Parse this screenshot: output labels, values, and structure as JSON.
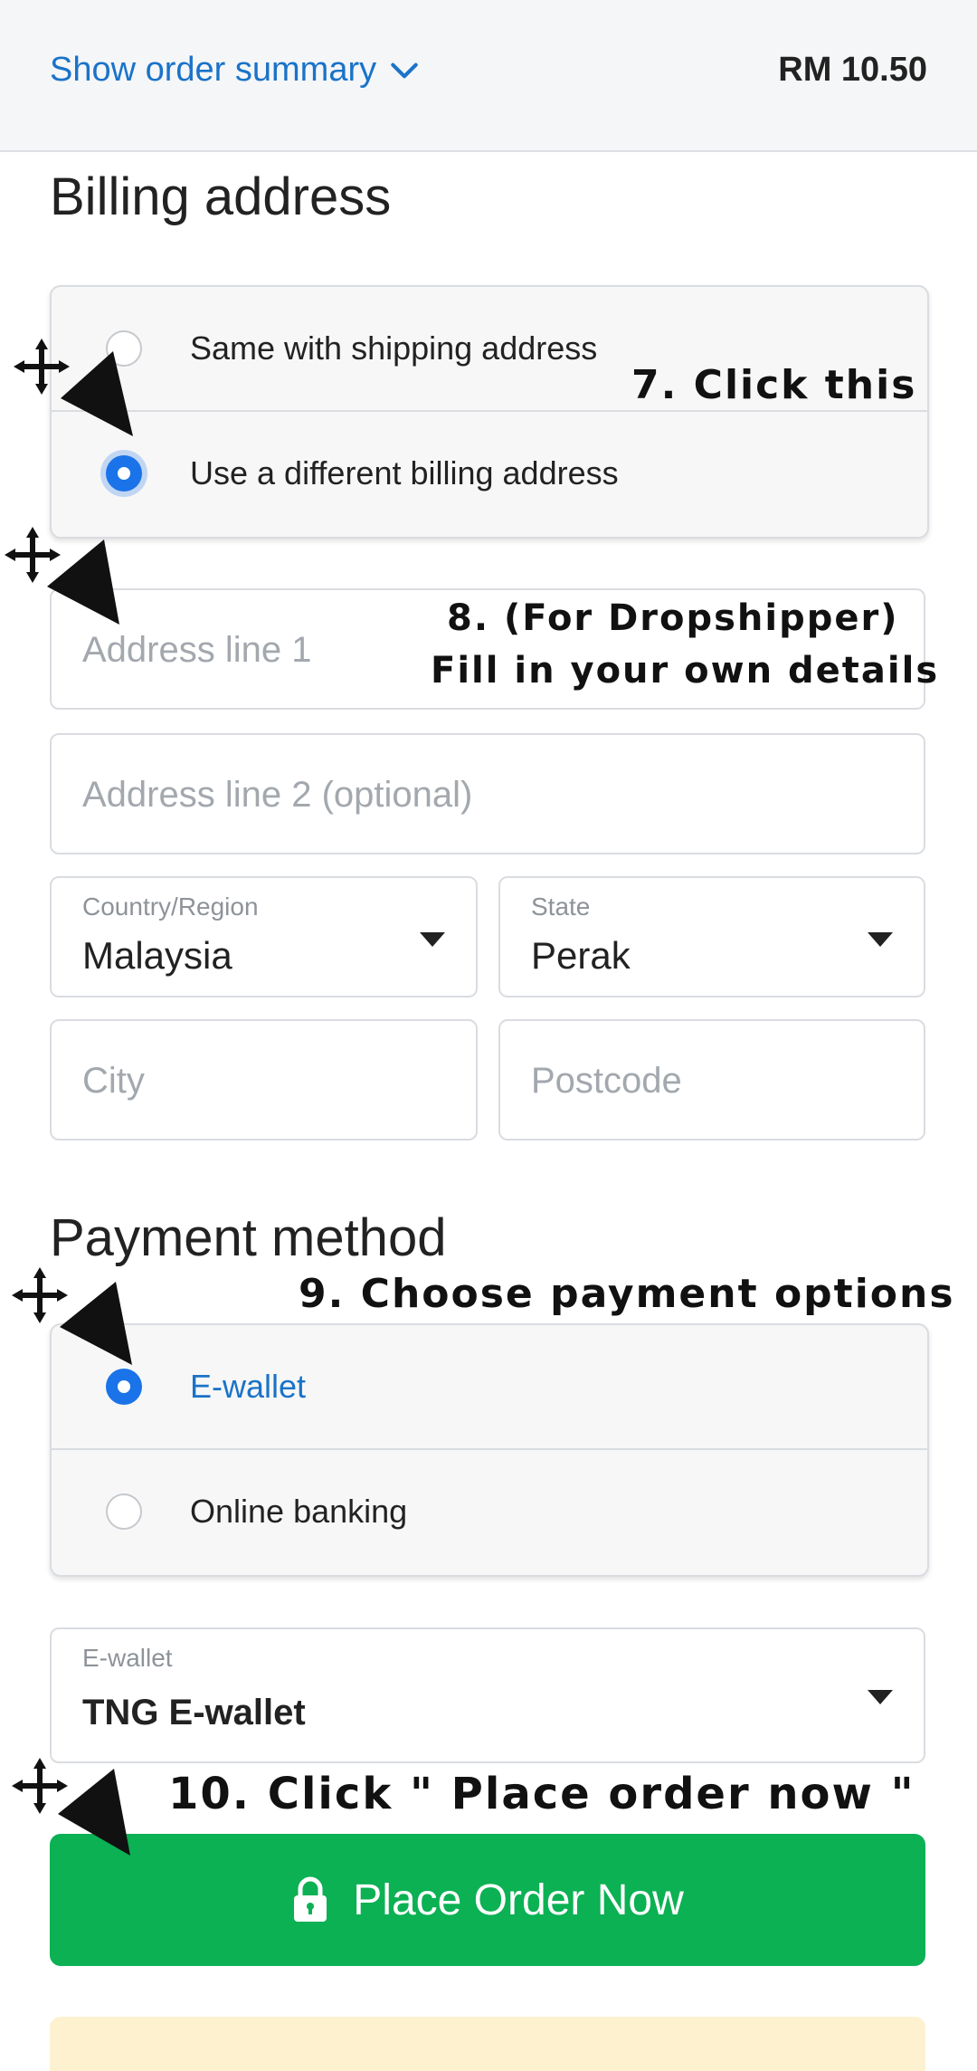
{
  "header": {
    "summary_label": "Show order summary",
    "total": "RM 10.50"
  },
  "billing": {
    "title": "Billing address",
    "options": [
      {
        "label": "Same with shipping address",
        "selected": false
      },
      {
        "label": "Use a different billing address",
        "selected": true
      }
    ],
    "address1_placeholder": "Address line 1",
    "address2_placeholder": "Address line 2 (optional)",
    "country_label": "Country/Region",
    "country_value": "Malaysia",
    "state_label": "State",
    "state_value": "Perak",
    "city_placeholder": "City",
    "postcode_placeholder": "Postcode"
  },
  "payment": {
    "title": "Payment method",
    "options": [
      {
        "label": "E-wallet",
        "selected": true
      },
      {
        "label": "Online banking",
        "selected": false
      }
    ],
    "wallet_label": "E-wallet",
    "wallet_value": "TNG E-wallet"
  },
  "place_order_label": "Place Order Now",
  "annotations": {
    "step7": "7. Click this",
    "step8_line1": "8. (For Dropshipper)",
    "step8_line2": "Fill in your own details",
    "step9": "9. Choose payment options",
    "step10": "10. Click \" Place order now \""
  },
  "icons": {
    "summary_chevron": "chevron-down-icon",
    "caret": "caret-down-icon",
    "lock": "lock-icon",
    "cursor": "move-cursor-arrow-icon"
  },
  "colors": {
    "accent_blue": "#1a73c8",
    "radio_blue": "#1a73e8",
    "button_green": "#0bb153",
    "notice_yellow": "#fdf1cf"
  }
}
